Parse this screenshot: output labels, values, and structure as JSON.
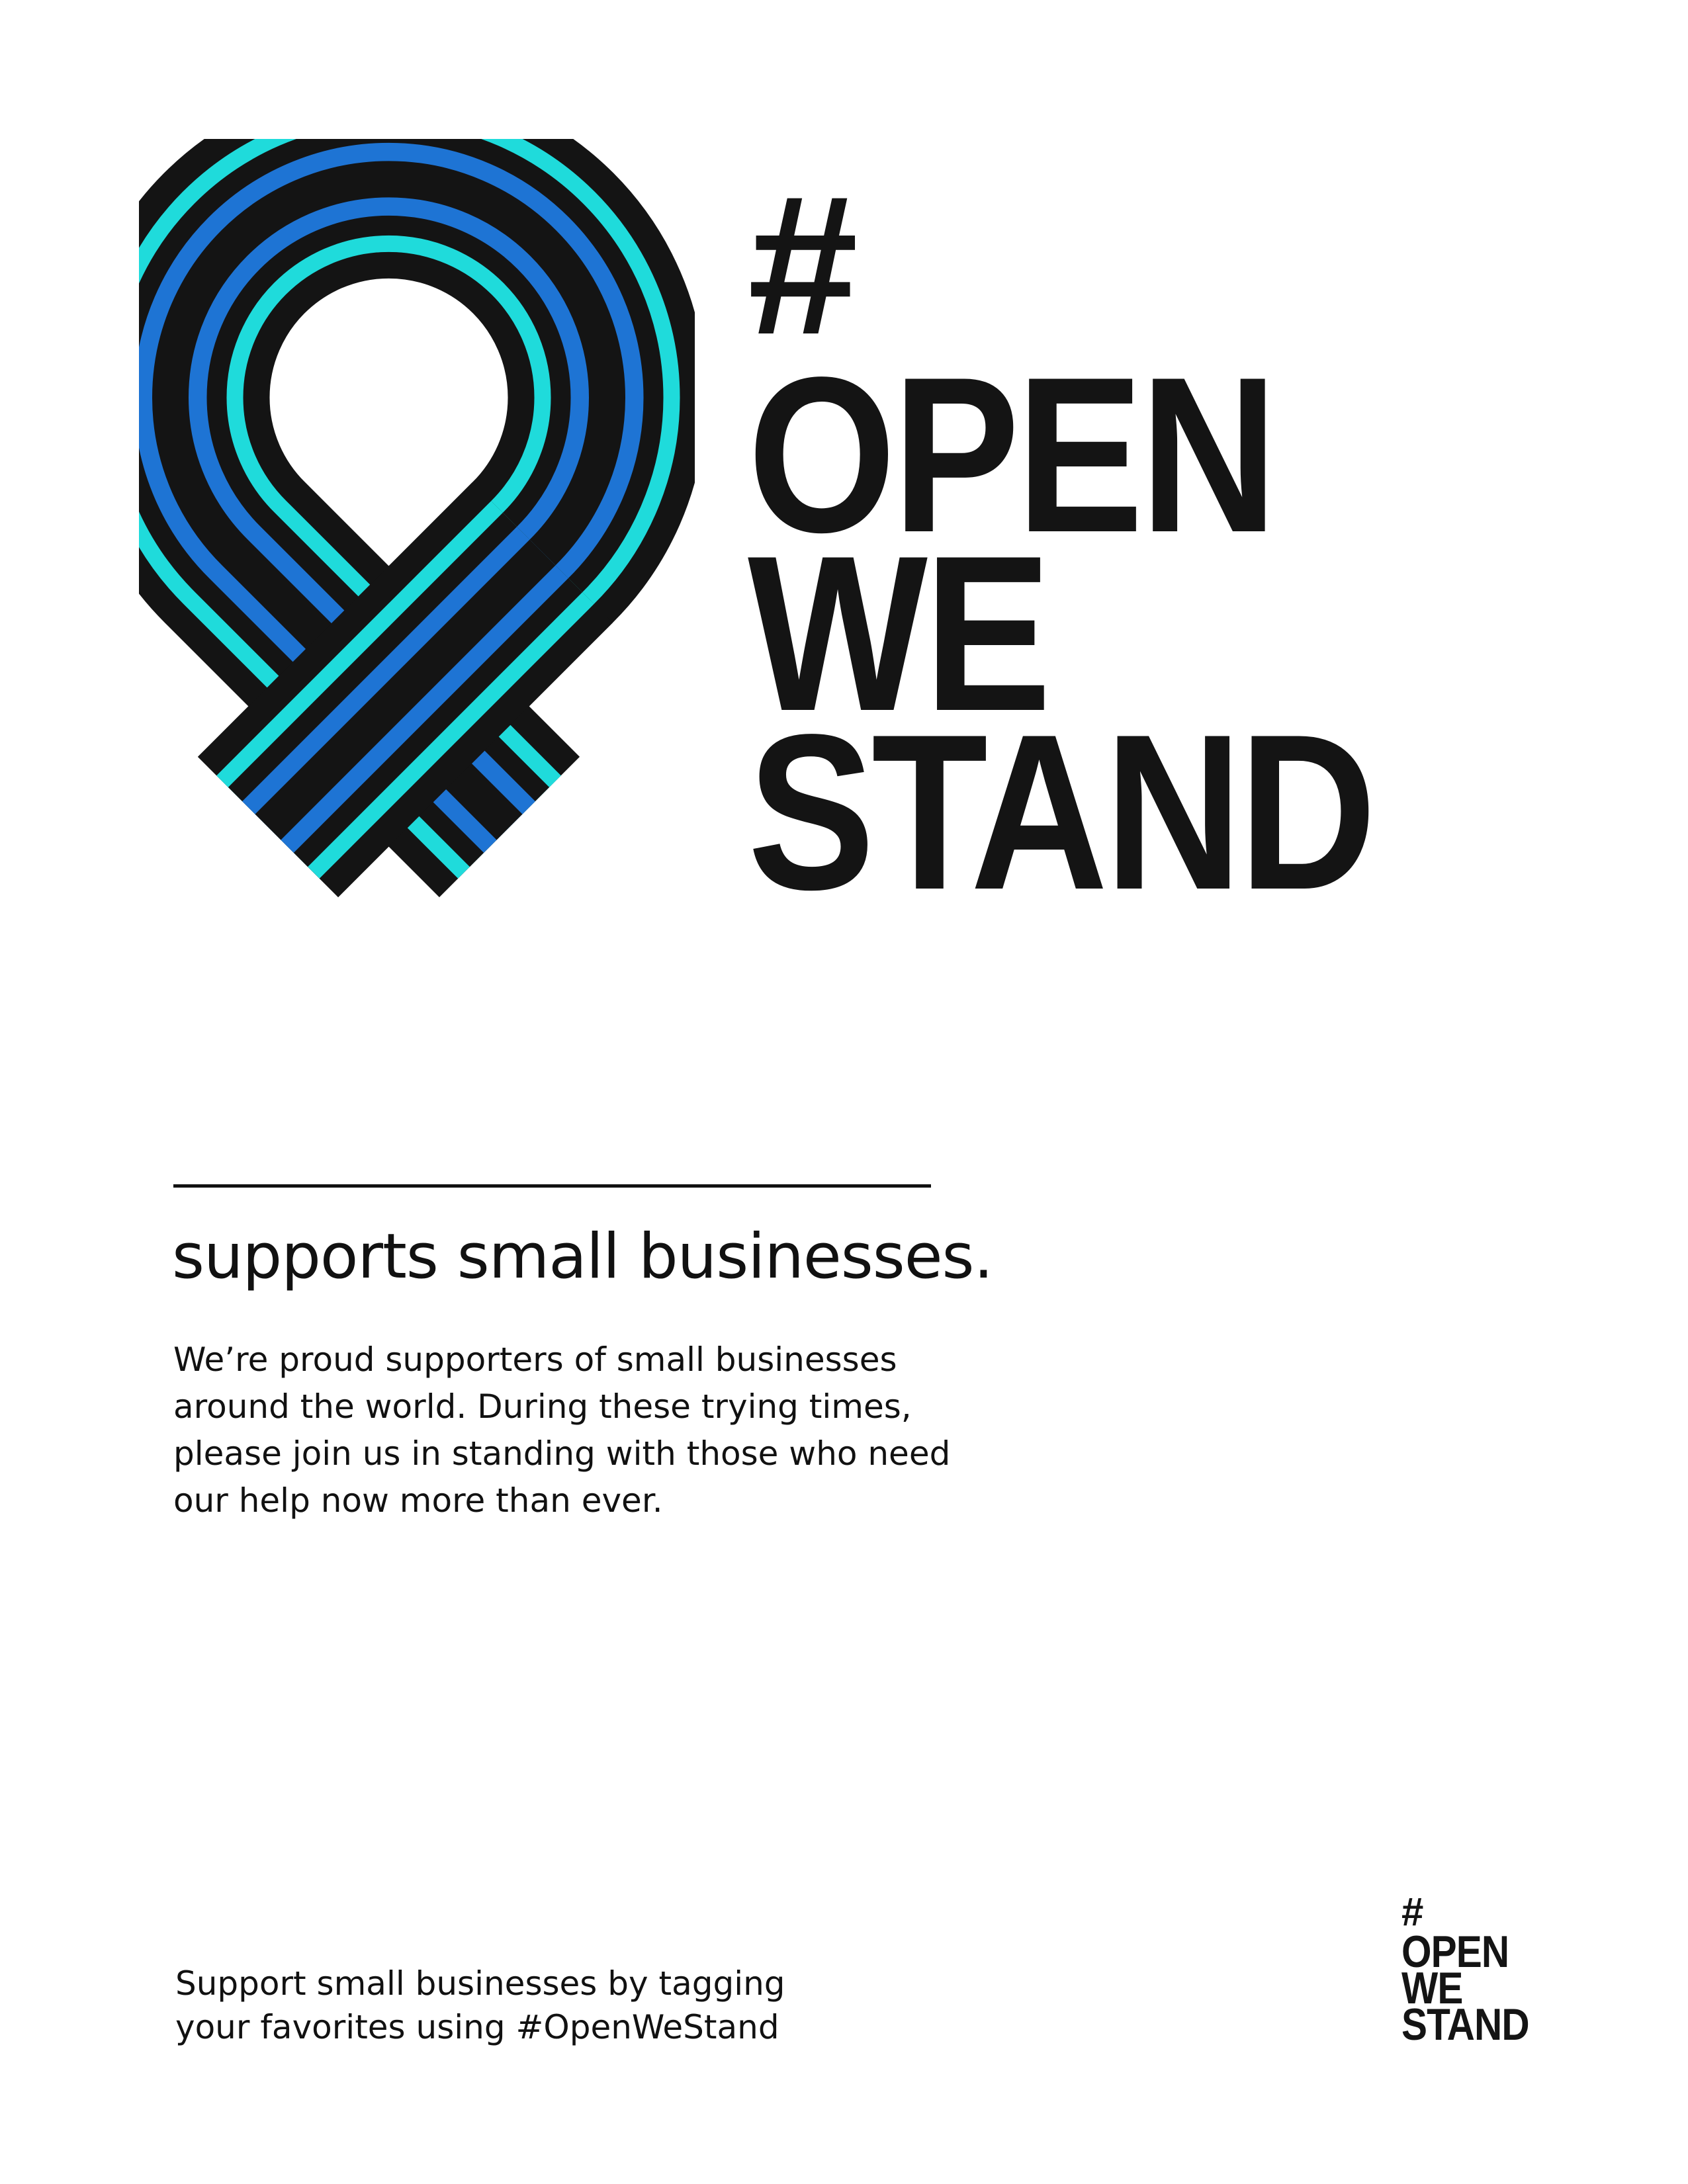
{
  "logo": {
    "hash": "#",
    "line1": "OPEN",
    "line2": "WE",
    "line3": "STAND"
  },
  "ribbon": {
    "icon": "awareness-ribbon-icon",
    "colors": {
      "outline": "#141414",
      "outer_band": "#1FDBDB",
      "inner_band": "#1E74D4"
    }
  },
  "tagline": "supports small businesses.",
  "body_text": "We’re proud supporters of small businesses around the world. During these trying times, please join us in standing with those who need our help now more than ever.",
  "footer": {
    "line1": "Support small businesses by tagging",
    "line2": "your favorites using #OpenWeStand"
  },
  "small_logo": {
    "hash": "#",
    "line1": "OPEN",
    "line2": "WE",
    "line3": "STAND"
  }
}
